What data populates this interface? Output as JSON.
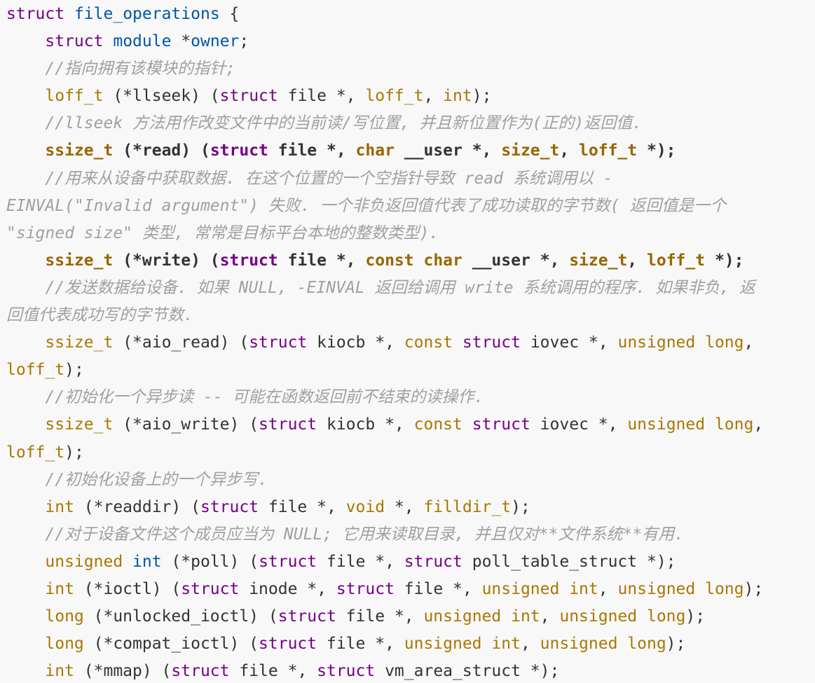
{
  "colors": {
    "background": "#f8f8f8",
    "plain": "#333333",
    "keyword": "#770088",
    "def": "#0055aa",
    "type": "#aa7700",
    "emph_type": "#996600",
    "emph_keyword": "#770088",
    "comment": "#a0a0a0"
  },
  "lines": [
    [
      [
        "k",
        "struct"
      ],
      [
        "p",
        " "
      ],
      [
        "d",
        "file_operations"
      ],
      [
        "p",
        " {"
      ]
    ],
    [
      [
        "p",
        "    "
      ],
      [
        "k",
        "struct"
      ],
      [
        "p",
        " "
      ],
      [
        "d",
        "module"
      ],
      [
        "p",
        " *"
      ],
      [
        "d",
        "owner"
      ],
      [
        "p",
        ";"
      ]
    ],
    [
      [
        "p",
        "    "
      ],
      [
        "c",
        "//指向拥有该模块的指针;"
      ]
    ],
    [
      [
        "p",
        "    "
      ],
      [
        "t",
        "loff_t"
      ],
      [
        "p",
        " (*llseek) ("
      ],
      [
        "k",
        "struct"
      ],
      [
        "p",
        " file *, "
      ],
      [
        "t",
        "loff_t"
      ],
      [
        "p",
        ", "
      ],
      [
        "t",
        "int"
      ],
      [
        "p",
        ");"
      ]
    ],
    [
      [
        "p",
        "    "
      ],
      [
        "c",
        "//llseek 方法用作改变文件中的当前读/写位置, 并且新位置作为(正的)返回值."
      ]
    ],
    [
      [
        "p",
        "    "
      ],
      [
        "bt",
        "ssize_t"
      ],
      [
        "b",
        " (*read) ("
      ],
      [
        "bk",
        "struct"
      ],
      [
        "b",
        " file *, "
      ],
      [
        "bt",
        "char"
      ],
      [
        "b",
        " __user *, "
      ],
      [
        "bt",
        "size_t"
      ],
      [
        "b",
        ", "
      ],
      [
        "bt",
        "loff_t"
      ],
      [
        "b",
        " *);"
      ]
    ],
    [
      [
        "p",
        "    "
      ],
      [
        "c",
        "//用来从设备中获取数据. 在这个位置的一个空指针导致 read 系统调用以 -"
      ]
    ],
    [
      [
        "c",
        "EINVAL(\"Invalid argument\") 失败. 一个非负返回值代表了成功读取的字节数( 返回值是一个"
      ]
    ],
    [
      [
        "c",
        "\"signed size\" 类型, 常常是目标平台本地的整数类型)."
      ]
    ],
    [
      [
        "p",
        "    "
      ],
      [
        "bt",
        "ssize_t"
      ],
      [
        "b",
        " (*write) ("
      ],
      [
        "bk",
        "struct"
      ],
      [
        "b",
        " file *, "
      ],
      [
        "bt",
        "const"
      ],
      [
        "b",
        " "
      ],
      [
        "bt",
        "char"
      ],
      [
        "b",
        " __user *, "
      ],
      [
        "bt",
        "size_t"
      ],
      [
        "b",
        ", "
      ],
      [
        "bt",
        "loff_t"
      ],
      [
        "b",
        " *);"
      ]
    ],
    [
      [
        "p",
        "    "
      ],
      [
        "c",
        "//发送数据给设备. 如果 NULL, -EINVAL 返回给调用 write 系统调用的程序. 如果非负, 返"
      ]
    ],
    [
      [
        "c",
        "回值代表成功写的字节数."
      ]
    ],
    [
      [
        "p",
        "    "
      ],
      [
        "t",
        "ssize_t"
      ],
      [
        "p",
        " (*aio_read) ("
      ],
      [
        "k",
        "struct"
      ],
      [
        "p",
        " kiocb *, "
      ],
      [
        "t",
        "const"
      ],
      [
        "p",
        " "
      ],
      [
        "k",
        "struct"
      ],
      [
        "p",
        " iovec *, "
      ],
      [
        "t",
        "unsigned"
      ],
      [
        "p",
        " "
      ],
      [
        "t",
        "long"
      ],
      [
        "p",
        ","
      ]
    ],
    [
      [
        "t",
        "loff_t"
      ],
      [
        "p",
        ");"
      ]
    ],
    [
      [
        "p",
        "    "
      ],
      [
        "c",
        "//初始化一个异步读 -- 可能在函数返回前不结束的读操作."
      ]
    ],
    [
      [
        "p",
        "    "
      ],
      [
        "t",
        "ssize_t"
      ],
      [
        "p",
        " (*aio_write) ("
      ],
      [
        "k",
        "struct"
      ],
      [
        "p",
        " kiocb *, "
      ],
      [
        "t",
        "const"
      ],
      [
        "p",
        " "
      ],
      [
        "k",
        "struct"
      ],
      [
        "p",
        " iovec *, "
      ],
      [
        "t",
        "unsigned"
      ],
      [
        "p",
        " "
      ],
      [
        "t",
        "long"
      ],
      [
        "p",
        ","
      ]
    ],
    [
      [
        "t",
        "loff_t"
      ],
      [
        "p",
        ");"
      ]
    ],
    [
      [
        "p",
        "    "
      ],
      [
        "c",
        "//初始化设备上的一个异步写."
      ]
    ],
    [
      [
        "p",
        "    "
      ],
      [
        "t",
        "int"
      ],
      [
        "p",
        " (*readdir) ("
      ],
      [
        "k",
        "struct"
      ],
      [
        "p",
        " file *, "
      ],
      [
        "t",
        "void"
      ],
      [
        "p",
        " *, "
      ],
      [
        "t",
        "filldir_t"
      ],
      [
        "p",
        ");"
      ]
    ],
    [
      [
        "p",
        "    "
      ],
      [
        "c",
        "//对于设备文件这个成员应当为 NULL; 它用来读取目录, 并且仅对**文件系统**有用."
      ]
    ],
    [
      [
        "p",
        "    "
      ],
      [
        "t",
        "unsigned"
      ],
      [
        "p",
        " "
      ],
      [
        "d",
        "int"
      ],
      [
        "p",
        " (*poll) ("
      ],
      [
        "k",
        "struct"
      ],
      [
        "p",
        " file *, "
      ],
      [
        "k",
        "struct"
      ],
      [
        "p",
        " poll_table_struct *);"
      ]
    ],
    [
      [
        "p",
        "    "
      ],
      [
        "t",
        "int"
      ],
      [
        "p",
        " (*ioctl) ("
      ],
      [
        "k",
        "struct"
      ],
      [
        "p",
        " inode *, "
      ],
      [
        "k",
        "struct"
      ],
      [
        "p",
        " file *, "
      ],
      [
        "t",
        "unsigned"
      ],
      [
        "p",
        " "
      ],
      [
        "t",
        "int"
      ],
      [
        "p",
        ", "
      ],
      [
        "t",
        "unsigned"
      ],
      [
        "p",
        " "
      ],
      [
        "t",
        "long"
      ],
      [
        "p",
        ");"
      ]
    ],
    [
      [
        "p",
        "    "
      ],
      [
        "t",
        "long"
      ],
      [
        "p",
        " (*unlocked_ioctl) ("
      ],
      [
        "k",
        "struct"
      ],
      [
        "p",
        " file *, "
      ],
      [
        "t",
        "unsigned"
      ],
      [
        "p",
        " "
      ],
      [
        "t",
        "int"
      ],
      [
        "p",
        ", "
      ],
      [
        "t",
        "unsigned"
      ],
      [
        "p",
        " "
      ],
      [
        "t",
        "long"
      ],
      [
        "p",
        ");"
      ]
    ],
    [
      [
        "p",
        "    "
      ],
      [
        "t",
        "long"
      ],
      [
        "p",
        " (*compat_ioctl) ("
      ],
      [
        "k",
        "struct"
      ],
      [
        "p",
        " file *, "
      ],
      [
        "t",
        "unsigned"
      ],
      [
        "p",
        " "
      ],
      [
        "t",
        "int"
      ],
      [
        "p",
        ", "
      ],
      [
        "t",
        "unsigned"
      ],
      [
        "p",
        " "
      ],
      [
        "t",
        "long"
      ],
      [
        "p",
        ");"
      ]
    ],
    [
      [
        "p",
        "    "
      ],
      [
        "t",
        "int"
      ],
      [
        "p",
        " (*mmap) ("
      ],
      [
        "k",
        "struct"
      ],
      [
        "p",
        " file *, "
      ],
      [
        "k",
        "struct"
      ],
      [
        "p",
        " vm_area_struct *);"
      ]
    ]
  ]
}
